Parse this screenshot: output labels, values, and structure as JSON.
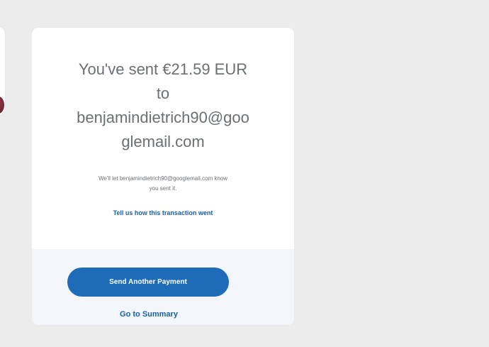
{
  "confirmation": {
    "headline_lines": [
      "You've sent €21.59 EUR",
      "to",
      "benjamindietrich90@goo",
      "glemail.com"
    ],
    "notice_lines": [
      "We'll let benjamindietrich90@googlemail.com know",
      "you sent it."
    ],
    "feedback_link": "Tell us how this transaction went"
  },
  "actions": {
    "send_another_label": "Send Another Payment",
    "summary_link": "Go to Summary"
  },
  "colors": {
    "page_background": "#ececec",
    "primary_button": "#1e6bb8",
    "link": "#1b5fa8",
    "bottom_panel": "#f2f5f9"
  }
}
